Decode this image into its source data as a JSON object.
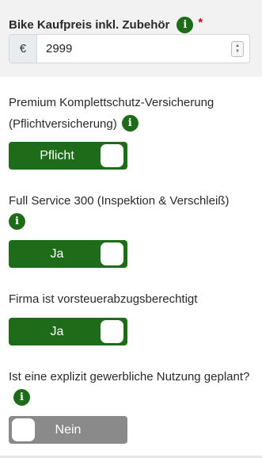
{
  "price": {
    "label": "Bike Kaufpreis inkl. Zubehör",
    "required_marker": "*",
    "currency": "€",
    "value": "2999",
    "stepper_up": "▲",
    "stepper_down": "▼"
  },
  "info_icon_glyph": "i",
  "fields": {
    "premium": {
      "label": "Premium Komplettschutz-Versicherung (Pflichtversicherung)",
      "toggle_text": "Pflicht",
      "state": "on"
    },
    "service": {
      "label": "Full Service 300 (Inspektion & Verschleiß)",
      "toggle_text": "Ja",
      "state": "on"
    },
    "vat": {
      "label": "Firma ist vorsteuerabzugsberechtigt",
      "toggle_text": "Ja",
      "state": "on"
    },
    "commercial": {
      "label": "Ist eine explizit gewerbliche Nutzung geplant?",
      "toggle_text": "Nein",
      "state": "off"
    }
  },
  "colors": {
    "toggle_on": "#1e6b1a",
    "toggle_off": "#8a8a8a",
    "info_icon": "#1e6b1a",
    "required": "#d0021b"
  }
}
